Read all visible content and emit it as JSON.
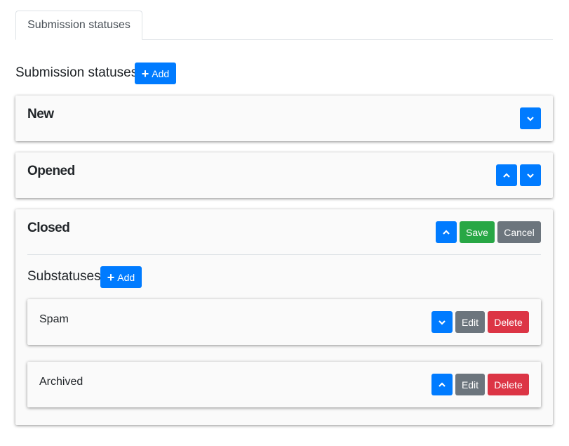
{
  "tabs": [
    {
      "label": "Submission statuses",
      "active": true
    }
  ],
  "section": {
    "title": "Submission statuses",
    "add_label": "Add"
  },
  "statuses": [
    {
      "title": "New"
    },
    {
      "title": "Opened"
    },
    {
      "title": "Closed",
      "save_label": "Save",
      "cancel_label": "Cancel",
      "substatuses_title": "Substatuses",
      "add_label": "Add",
      "substatuses": [
        {
          "title": "Spam",
          "edit_label": "Edit",
          "delete_label": "Delete"
        },
        {
          "title": "Archived",
          "edit_label": "Edit",
          "delete_label": "Delete"
        }
      ]
    }
  ],
  "colors": {
    "primary": "#007bff",
    "success": "#28a745",
    "secondary": "#6c757d",
    "danger": "#dc3545"
  }
}
